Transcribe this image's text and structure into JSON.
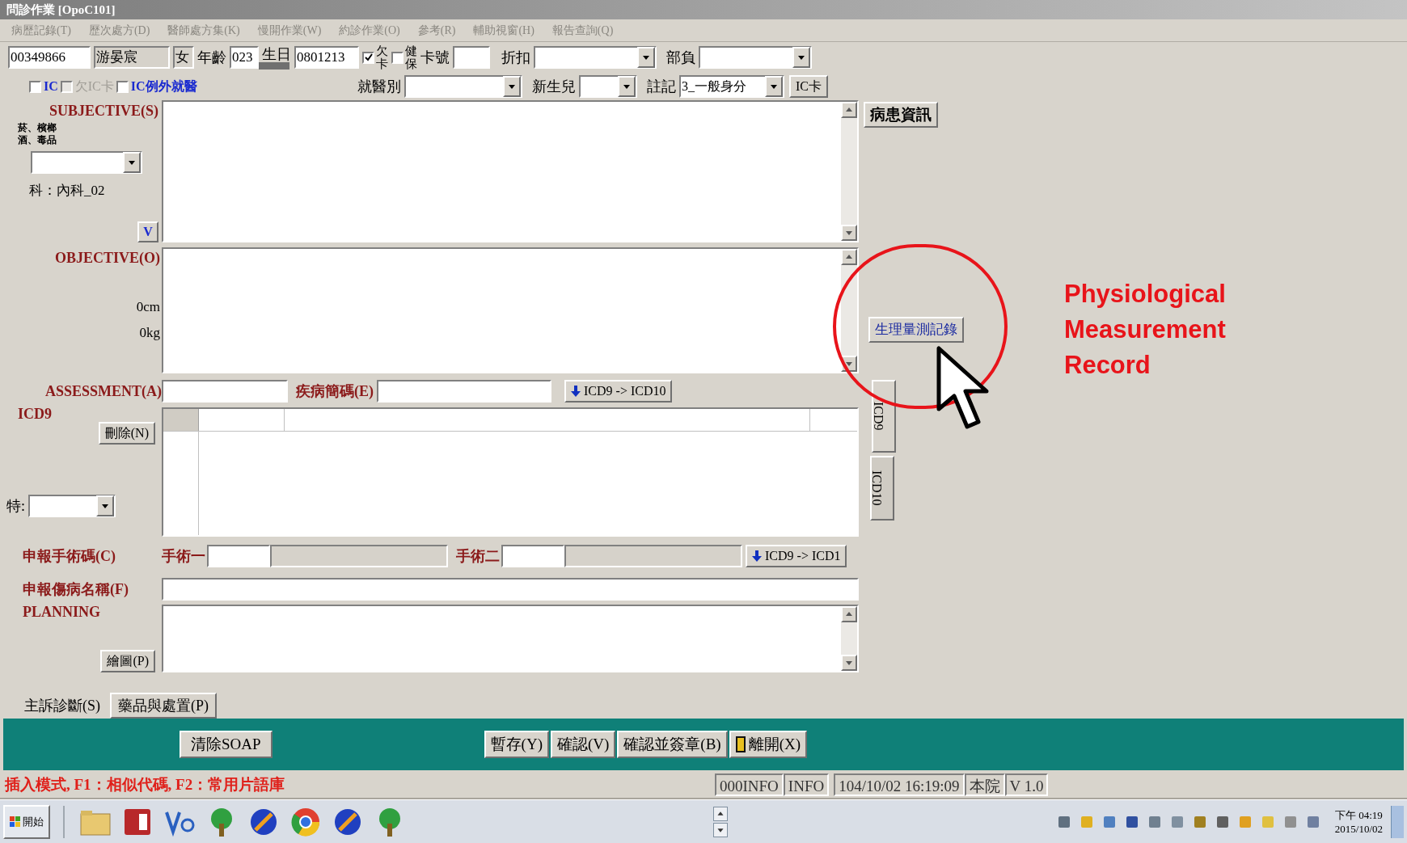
{
  "window": {
    "title": "問診作業 [OpoC101]"
  },
  "menu": [
    {
      "label": "病歷記錄(T)",
      "disabled": true
    },
    {
      "label": "歷次處方(D)",
      "disabled": true
    },
    {
      "label": "醫師處方集(K)",
      "disabled": true
    },
    {
      "label": "慢開作業(W)",
      "disabled": true
    },
    {
      "label": "約診作業(O)",
      "disabled": true
    },
    {
      "label": "參考(R)",
      "disabled": true
    },
    {
      "label": "輔助視窗(H)",
      "disabled": true
    },
    {
      "label": "報告查詢(Q)",
      "disabled": true
    }
  ],
  "patient": {
    "chart_no": "00349866",
    "name": "游晏宸",
    "sex": "女",
    "age_label": "年齡",
    "age": "023",
    "birth_label": "生日",
    "birthday": "0801213",
    "flags": [
      {
        "label": "欠卡",
        "checked": true
      },
      {
        "label": "健保",
        "checked": false
      }
    ],
    "card_label": "卡號",
    "discount_label": "折扣",
    "copay_label": "部負"
  },
  "ic_options": [
    {
      "label": "IC",
      "checked": false,
      "disabled": false
    },
    {
      "label": "欠IC卡",
      "checked": false,
      "disabled": true
    },
    {
      "label": "IC例外就醫",
      "checked": false,
      "disabled": false
    }
  ],
  "visit_selects": [
    {
      "label": "就醫別"
    },
    {
      "label": "新生兒"
    },
    {
      "label": "註記",
      "value": "3_一般身分"
    }
  ],
  "ic_card_button": "IC卡",
  "subjective": {
    "label": "SUBJECTIVE(S)",
    "habits": [
      "菸、檳榔",
      "酒、毒品"
    ],
    "department": "科：內科_02",
    "v_button": "V"
  },
  "objective": {
    "label": "OBJECTIVE(O)",
    "height": "0cm",
    "weight": "0kg"
  },
  "assessment": {
    "label": "ASSESSMENT(A)",
    "code_label": "疾病簡碼(E)",
    "convert_button": "ICD9 -> ICD10",
    "icd_label": "ICD9",
    "delete_button": "刪除(N)",
    "special_label": "特:"
  },
  "surgery": {
    "label": "申報手術碼(C)",
    "first_label": "手術一",
    "second_label": "手術二",
    "convert_button": "ICD9 -> ICD1"
  },
  "disease_name": {
    "label": "申報傷病名稱(F)"
  },
  "planning": {
    "label": "PLANNING",
    "draw_button": "繪圖(P)"
  },
  "side": {
    "patient_info_button": "病患資訊",
    "measurement_button": "生理量測記錄",
    "code_tabs": [
      {
        "label": "ICD9",
        "selected": true
      },
      {
        "label": "ICD10",
        "selected": false
      }
    ]
  },
  "tabs": [
    {
      "label": "主訴診斷(S)",
      "selected": true
    },
    {
      "label": "藥品與處置(P)",
      "selected": false
    }
  ],
  "actions": {
    "clear_button": "清除SOAP",
    "buttons": [
      {
        "label": "暫存(Y)",
        "kind": "plain"
      },
      {
        "label": "確認(V)",
        "kind": "plain"
      },
      {
        "label": "確認並簽章(B)",
        "kind": "plain"
      },
      {
        "label": "離開(X)",
        "kind": "exit"
      }
    ]
  },
  "status_bar": {
    "hint": "插入模式, F1：相似代碼, F2：常用片語庫",
    "fields": [
      "000INFO",
      "INFO",
      "104/10/02 16:19:09",
      "本院",
      "V 1.0"
    ]
  },
  "taskbar": {
    "start": "開始",
    "time": "下午 04:19",
    "date": "2015/10/02"
  },
  "annotation": {
    "text": "Physiological Measurement Record"
  }
}
